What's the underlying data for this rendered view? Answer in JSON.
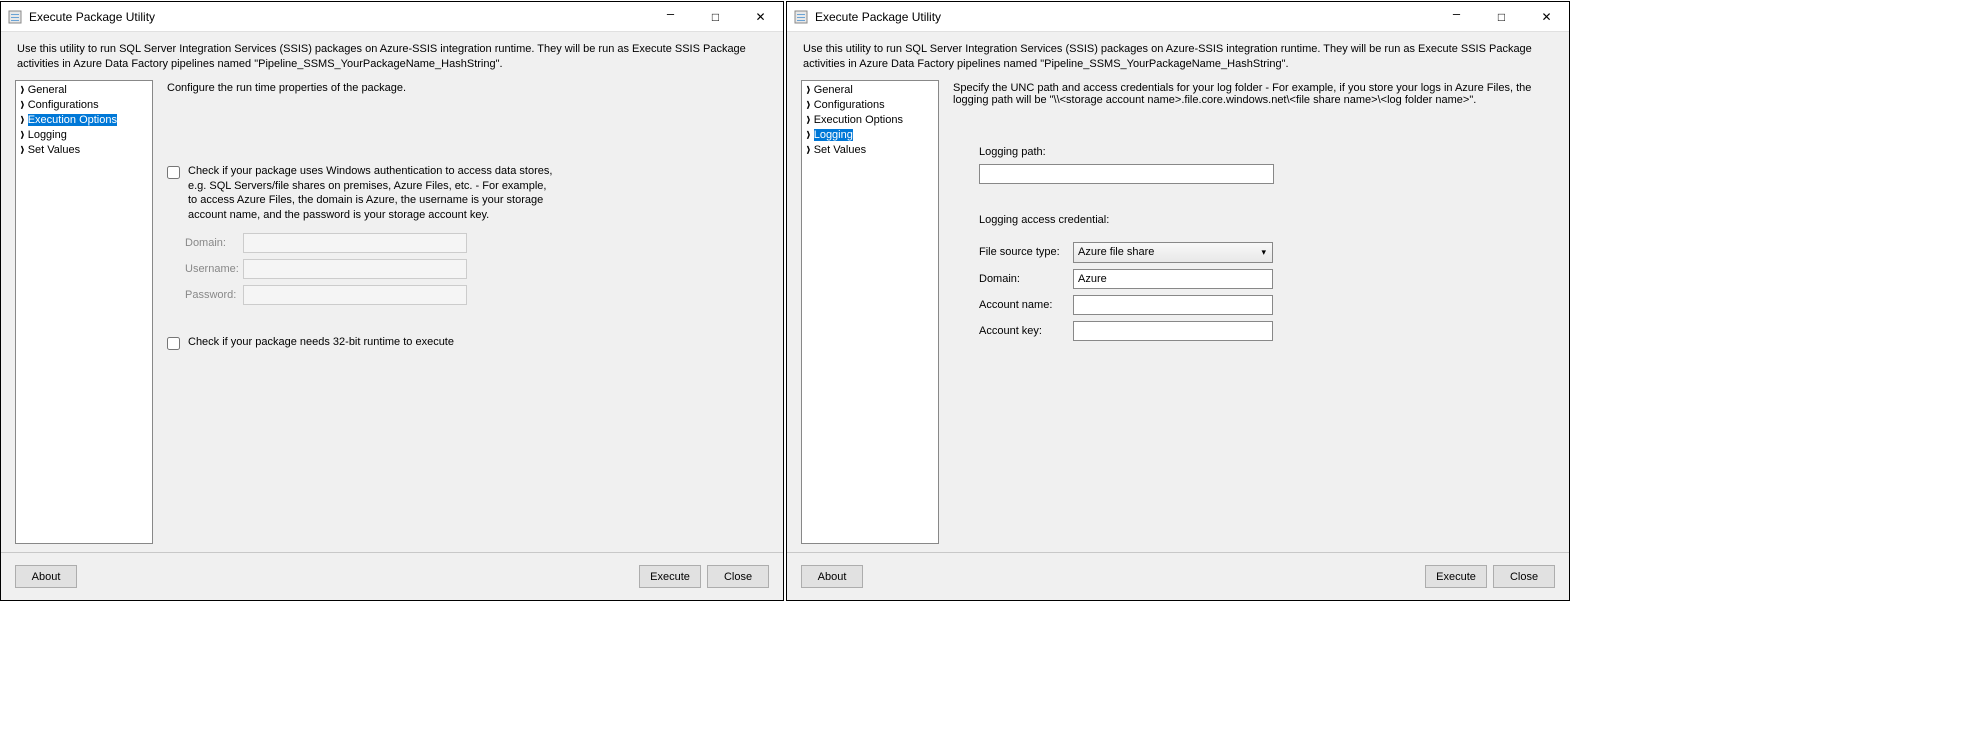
{
  "left": {
    "title": "Execute Package Utility",
    "description": "Use this utility to run SQL Server Integration Services (SSIS) packages on Azure-SSIS integration runtime. They will be run as Execute SSIS Package activities in Azure Data Factory pipelines named \"Pipeline_SSMS_YourPackageName_HashString\".",
    "nav": {
      "general": "General",
      "configurations": "Configurations",
      "execution_options": "Execution Options",
      "logging": "Logging",
      "set_values": "Set Values"
    },
    "content_header": "Configure the run time properties of the package.",
    "checkbox1_label": "Check if your package uses Windows authentication to access data stores, e.g. SQL Servers/file shares on premises, Azure Files, etc. - For example, to access Azure Files, the domain is Azure, the username is your storage account name, and the password is your storage account key.",
    "form": {
      "domain_label": "Domain:",
      "domain_value": "",
      "username_label": "Username:",
      "username_value": "",
      "password_label": "Password:",
      "password_value": ""
    },
    "checkbox2_label": "Check if your package needs 32-bit runtime to execute",
    "buttons": {
      "about": "About",
      "execute": "Execute",
      "close": "Close"
    }
  },
  "right": {
    "title": "Execute Package Utility",
    "description": "Use this utility to run SQL Server Integration Services (SSIS) packages on Azure-SSIS integration runtime. They will be run as Execute SSIS Package activities in Azure Data Factory pipelines named \"Pipeline_SSMS_YourPackageName_HashString\".",
    "nav": {
      "general": "General",
      "configurations": "Configurations",
      "execution_options": "Execution Options",
      "logging": "Logging",
      "set_values": "Set Values"
    },
    "content_header": "Specify the UNC path and access credentials for your log folder - For example, if you store your logs in Azure Files, the logging path will be \"\\\\<storage account name>.file.core.windows.net\\<file share name>\\<log folder name>\".",
    "logging": {
      "path_label": "Logging path:",
      "path_value": "",
      "cred_header": "Logging access credential:",
      "file_source_label": "File source type:",
      "file_source_value": "Azure file share",
      "domain_label": "Domain:",
      "domain_value": "Azure",
      "account_name_label": "Account name:",
      "account_name_value": "",
      "account_key_label": "Account key:",
      "account_key_value": ""
    },
    "buttons": {
      "about": "About",
      "execute": "Execute",
      "close": "Close"
    }
  }
}
